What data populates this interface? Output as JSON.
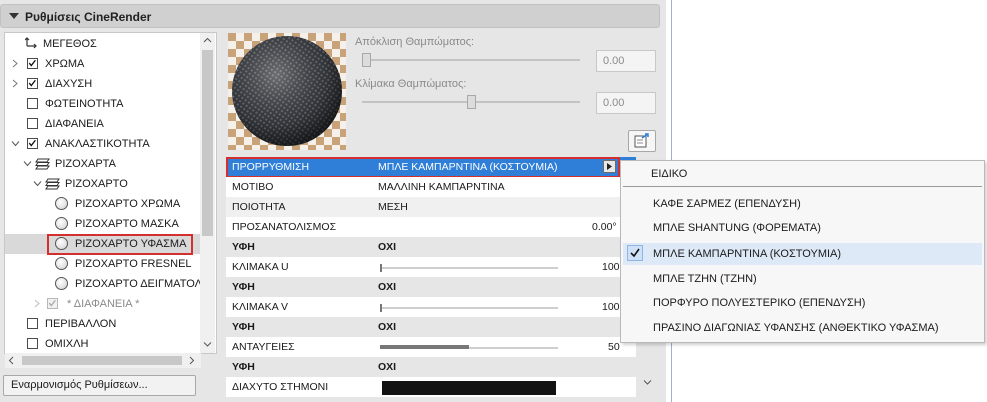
{
  "panel": {
    "title": "Ρυθμίσεις CineRender",
    "bottom_button": "Εναρμονισμός Ρυθμίσεων..."
  },
  "tree": {
    "items": [
      {
        "label": "ΜΕΓΕΘΟΣ",
        "checkbox": null
      },
      {
        "label": "ΧΡΩΜΑ",
        "checkbox": true
      },
      {
        "label": "ΔΙΑΧΥΣΗ",
        "checkbox": true
      },
      {
        "label": "ΦΩΤΕΙΝΟΤΗΤΑ",
        "checkbox": false
      },
      {
        "label": "ΔΙΑΦΑΝΕΙΑ",
        "checkbox": false
      },
      {
        "label": "ΑΝΑΚΛΑΣΤΙΚΟΤΗΤΑ",
        "checkbox": true
      },
      {
        "label": "ΡΙΖΟΧΑΡΤΑ"
      },
      {
        "label": "ΡΙΖΟΧΑΡΤΟ"
      },
      {
        "label": "ΡΙΖΟΧΑΡΤΟ ΧΡΩΜΑ"
      },
      {
        "label": "ΡΙΖΟΧΑΡΤΟ ΜΑΣΚΑ"
      },
      {
        "label": "ΡΙΖΟΧΑΡΤΟ ΥΦΑΣΜΑ",
        "selected": true
      },
      {
        "label": "ΡΙΖΟΧΑΡΤΟ FRESNEL"
      },
      {
        "label": "ΡΙΖΟΧΑΡΤΟ ΔΕΙΓΜΑΤΟΛ"
      },
      {
        "label": "* ΔΙΑΦΑΝΕΙΑ *",
        "checkbox": true,
        "disabled": true
      },
      {
        "label": "ΠΕΡΙΒΑΛΛΟΝ",
        "checkbox": false
      },
      {
        "label": "ΟΜΙΧΛΗ",
        "checkbox": false
      }
    ]
  },
  "sliders": {
    "deviation_label": "Απόκλιση Θαμπώματος:",
    "deviation_value": "0.00",
    "scale_label": "Κλίμακα Θαμπώματος:",
    "scale_value": "0.00"
  },
  "props": {
    "preset": {
      "name": "ΠΡΟΡΡΥΘΜΙΣΗ",
      "value": "ΜΠΛΕ ΚΑΜΠΑΡΝΤΙΝΑ (ΚΟΣΤΟΥΜΙΑ)"
    },
    "pattern": {
      "name": "ΜΟΤΙΒΟ",
      "value": "ΜΑΛΛΙΝΗ ΚΑΜΠΑΡΝΤΙΝΑ"
    },
    "quality": {
      "name": "ΠΟΙΟΤΗΤΑ",
      "value": "ΜΕΣΗ"
    },
    "orientation": {
      "name": "ΠΡΟΣΑΝΑΤΟΛΙΣΜΟΣ",
      "value": "0.00°"
    },
    "texture1": {
      "name": "ΥΦΗ",
      "value": "ΟΧΙ"
    },
    "scale_u": {
      "name": "ΚΛΙΜΑΚΑ U",
      "value": "100",
      "level": 0.0
    },
    "texture2": {
      "name": "ΥΦΗ",
      "value": "ΟΧΙ"
    },
    "scale_v": {
      "name": "ΚΛΙΜΑΚΑ V",
      "value": "100",
      "level": 0.0
    },
    "texture3": {
      "name": "ΥΦΗ",
      "value": "ΟΧΙ"
    },
    "highlights": {
      "name": "ΑΝΤΑΥΓΕΙΕΣ",
      "value": "50",
      "level": 0.5
    },
    "texture4": {
      "name": "ΥΦΗ",
      "value": "ΟΧΙ"
    },
    "diffuse_thread": {
      "name": "ΔΙΑΧΥΤΟ ΣΤΗΜΟΝΙ",
      "color": "#121212"
    }
  },
  "menu": {
    "header": "ΕΙΔΙΚΟ",
    "items": [
      "ΚΑΦΕ ΣΑΡΜΕΖ (ΕΠΕΝΔΥΣΗ)",
      "ΜΠΛΕ SHANTUNG (ΦΟΡΕΜΑΤΑ)",
      "ΜΠΛΕ ΚΑΜΠΑΡΝΤΙΝΑ (ΚΟΣΤΟΥΜΙΑ)",
      "ΜΠΛΕ ΤΖΗΝ (ΤΖΗΝ)",
      "ΠΟΡΦΥΡΟ ΠΟΛΥΕΣΤΕΡΙΚΟ (ΕΠΕΝΔΥΣΗ)",
      "ΠΡΑΣΙΝΟ ΔΙΑΓΩΝΙΑΣ ΥΦΑΝΣΗΣ (ΑΝΘΕΚΤΙΚΟ ΥΦΑΣΜΑ)"
    ],
    "checked_index": 2
  },
  "colors": {
    "selection_blue": "#2f7fd8",
    "highlight_red": "#d32f2f",
    "menu_hover": "#dde9f7"
  }
}
